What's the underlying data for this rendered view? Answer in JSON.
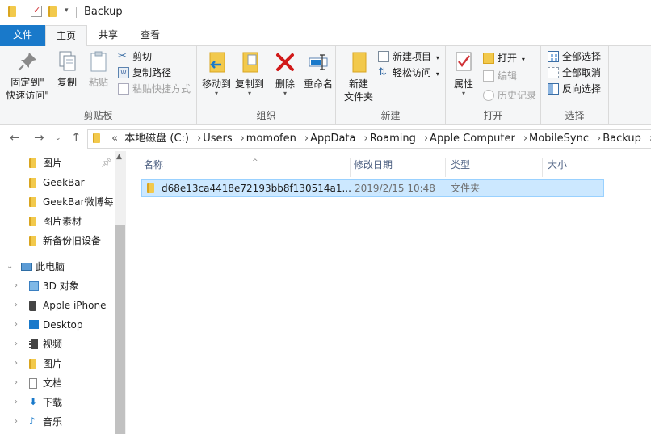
{
  "window": {
    "title": "Backup"
  },
  "ribbon_tabs": [
    "文件",
    "主页",
    "共享",
    "查看"
  ],
  "ribbon": {
    "clipboard": {
      "pin_label_1": "固定到\"",
      "pin_label_2": "快速访问\"",
      "copy": "复制",
      "paste": "粘贴",
      "cut": "剪切",
      "copy_path": "复制路径",
      "paste_shortcut": "粘贴快捷方式",
      "group": "剪贴板"
    },
    "organize": {
      "move_to": "移动到",
      "copy_to": "复制到",
      "delete": "删除",
      "rename": "重命名",
      "group": "组织"
    },
    "new": {
      "new_folder_1": "新建",
      "new_folder_2": "文件夹",
      "new_item": "新建项目",
      "easy_access": "轻松访问",
      "group": "新建"
    },
    "open": {
      "properties": "属性",
      "open": "打开",
      "edit": "编辑",
      "history": "历史记录",
      "group": "打开"
    },
    "select": {
      "select_all": "全部选择",
      "select_none": "全部取消",
      "invert": "反向选择",
      "group": "选择"
    }
  },
  "address": {
    "overflow": "«",
    "crumbs": [
      "本地磁盘 (C:)",
      "Users",
      "momofen",
      "AppData",
      "Roaming",
      "Apple Computer",
      "MobileSync",
      "Backup"
    ]
  },
  "nav_pane": {
    "quick_access": [
      "图片",
      "GeekBar",
      "GeekBar微博每日",
      "图片素材",
      "新备份旧设备"
    ],
    "this_pc": "此电脑",
    "pc_items": [
      "3D 对象",
      "Apple iPhone",
      "Desktop",
      "视频",
      "图片",
      "文档",
      "下载",
      "音乐"
    ]
  },
  "columns": [
    "名称",
    "修改日期",
    "类型",
    "大小"
  ],
  "files": [
    {
      "name": "d68e13ca4418e72193bb8f130514a1...",
      "date": "2019/2/15 10:48",
      "type": "文件夹",
      "size": ""
    }
  ]
}
